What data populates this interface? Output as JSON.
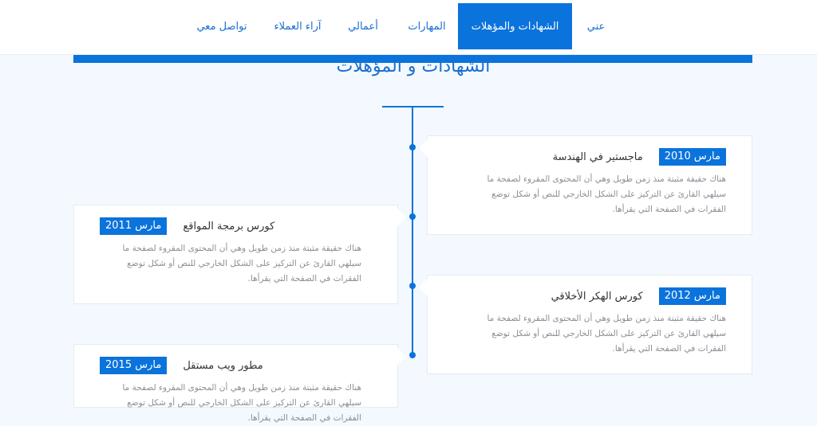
{
  "nav": {
    "items": [
      {
        "label": "عني",
        "active": false
      },
      {
        "label": "الشهادات والمؤهلات",
        "active": true
      },
      {
        "label": "المهارات",
        "active": false
      },
      {
        "label": "أعمالي",
        "active": false
      },
      {
        "label": "آراء العملاء",
        "active": false
      },
      {
        "label": "تواصل معي",
        "active": false
      }
    ]
  },
  "section": {
    "title": "الشهادات و المؤهلات"
  },
  "timeline": [
    {
      "side": "right",
      "date": "مارس 2010",
      "title": "ماجستير في الهندسة",
      "text": "هناك حقيقة مثبتة منذ زمن طويل وهي أن المحتوى المقروء لصفحة ما سيلهي القارئ عن التركيز على الشكل الخارجي للنص أو شكل توضع الفقرات في الصفحة التي يقرأها."
    },
    {
      "side": "left",
      "date": "مارس 2011",
      "title": "كورس برمجة المواقع",
      "text": "هناك حقيقة مثبتة منذ زمن طويل وهي أن المحتوى المقروء لصفحة ما سيلهي القارئ عن التركيز على الشكل الخارجي للنص أو شكل توضع الفقرات في الصفحة التي يقرأها."
    },
    {
      "side": "right",
      "date": "مارس 2012",
      "title": "كورس الهكر الأخلاقي",
      "text": "هناك حقيقة مثبتة منذ زمن طويل وهي أن المحتوى المقروء لصفحة ما سيلهي القارئ عن التركيز على الشكل الخارجي للنص أو شكل توضع الفقرات في الصفحة التي يقرأها."
    },
    {
      "side": "left",
      "date": "مارس 2015",
      "title": "مطور ويب مستقل",
      "text": "هناك حقيقة مثبتة منذ زمن طويل وهي أن المحتوى المقروء لصفحة ما سيلهي القارئ عن التركيز على الشكل الخارجي للنص أو شكل توضع الفقرات في الصفحة التي يقرأها."
    }
  ],
  "colors": {
    "accent": "#0a73dc",
    "background": "#f3f9fe",
    "text_muted": "#8a8f96"
  }
}
